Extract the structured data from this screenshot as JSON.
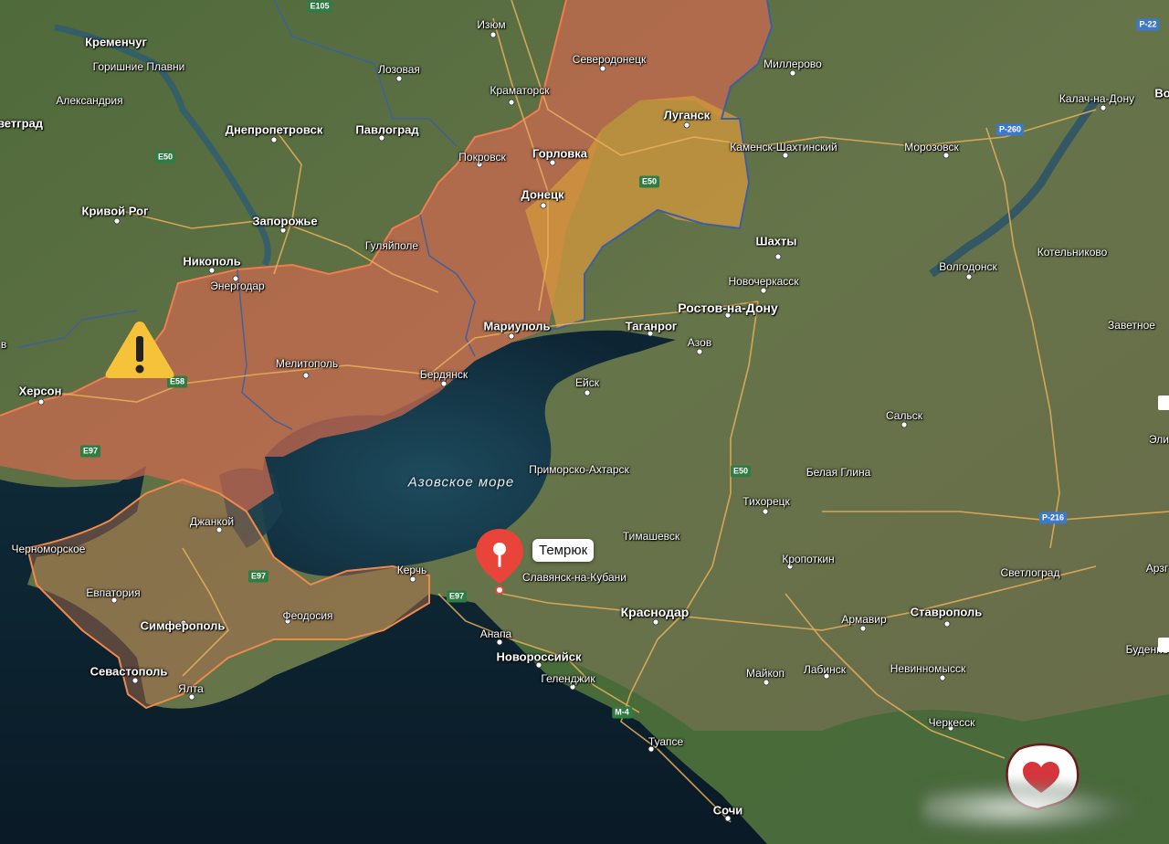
{
  "map": {
    "colors": {
      "land": "#5b6f3c",
      "water": "#0f2a3a",
      "occupied": "#d0684d",
      "occupied_pre2022": "#cf9b3c",
      "border": "#ef7a4a",
      "admin": "#3c5fa0",
      "road": "#e8b05a",
      "pin": "#e8443a"
    },
    "sea_label": "Азовское море",
    "cities": [
      {
        "name": "Кременчуг",
        "style": "big"
      },
      {
        "name": "Горишние Плавни",
        "style": ""
      },
      {
        "name": "Александрия",
        "style": ""
      },
      {
        "name": "ветград",
        "style": "big"
      },
      {
        "name": "Днепропетровск",
        "style": "big"
      },
      {
        "name": "Павлоград",
        "style": "big"
      },
      {
        "name": "Кривой Рог",
        "style": "big"
      },
      {
        "name": "Запорожье",
        "style": "big"
      },
      {
        "name": "Никополь",
        "style": "big"
      },
      {
        "name": "Энергодар",
        "style": ""
      },
      {
        "name": "Херсон",
        "style": "big"
      },
      {
        "name": "Мелитополь",
        "style": ""
      },
      {
        "name": "Бердянск",
        "style": ""
      },
      {
        "name": "Гуляйполе",
        "style": ""
      },
      {
        "name": "Мариуполь",
        "style": "big"
      },
      {
        "name": "Изюм",
        "style": ""
      },
      {
        "name": "Лозовая",
        "style": ""
      },
      {
        "name": "Краматорск",
        "style": ""
      },
      {
        "name": "Северодонецк",
        "style": ""
      },
      {
        "name": "Луганск",
        "style": "big"
      },
      {
        "name": "Покровск",
        "style": ""
      },
      {
        "name": "Горловка",
        "style": "big"
      },
      {
        "name": "Донецк",
        "style": "big"
      },
      {
        "name": "Миллерово",
        "style": ""
      },
      {
        "name": "Каменск-Шахтинский",
        "style": ""
      },
      {
        "name": "Морозовск",
        "style": ""
      },
      {
        "name": "Калач-на-Дону",
        "style": ""
      },
      {
        "name": "Шахты",
        "style": "big"
      },
      {
        "name": "Новочеркасск",
        "style": ""
      },
      {
        "name": "Ростов-на-Дону",
        "style": "major"
      },
      {
        "name": "Таганрог",
        "style": "big"
      },
      {
        "name": "Азов",
        "style": ""
      },
      {
        "name": "Волгодонск",
        "style": ""
      },
      {
        "name": "Котельниково",
        "style": ""
      },
      {
        "name": "Заветное",
        "style": ""
      },
      {
        "name": "Ейск",
        "style": ""
      },
      {
        "name": "Сальск",
        "style": ""
      },
      {
        "name": "Приморско-Ахтарск",
        "style": ""
      },
      {
        "name": "Белая Глина",
        "style": ""
      },
      {
        "name": "Тихорецк",
        "style": ""
      },
      {
        "name": "Тимашевск",
        "style": ""
      },
      {
        "name": "Кропоткин",
        "style": ""
      },
      {
        "name": "Светлоград",
        "style": ""
      },
      {
        "name": "Славянск-на-Кубани",
        "style": ""
      },
      {
        "name": "Краснодар",
        "style": "major"
      },
      {
        "name": "Армавир",
        "style": ""
      },
      {
        "name": "Ставрополь",
        "style": "big"
      },
      {
        "name": "Анапа",
        "style": ""
      },
      {
        "name": "Новороссийск",
        "style": "big"
      },
      {
        "name": "Геленджик",
        "style": ""
      },
      {
        "name": "Майкоп",
        "style": ""
      },
      {
        "name": "Лабинск",
        "style": ""
      },
      {
        "name": "Невинномысск",
        "style": ""
      },
      {
        "name": "Черкесск",
        "style": ""
      },
      {
        "name": "Туапсе",
        "style": ""
      },
      {
        "name": "Сочи",
        "style": "big"
      },
      {
        "name": "Джанкой",
        "style": ""
      },
      {
        "name": "Черноморское",
        "style": ""
      },
      {
        "name": "Керчь",
        "style": ""
      },
      {
        "name": "Евпатория",
        "style": ""
      },
      {
        "name": "Симферополь",
        "style": "big"
      },
      {
        "name": "Феодосия",
        "style": ""
      },
      {
        "name": "Севастополь",
        "style": "big"
      },
      {
        "name": "Ялта",
        "style": ""
      },
      {
        "name": "Буденно",
        "style": ""
      },
      {
        "name": "Арзг",
        "style": ""
      },
      {
        "name": "Эли",
        "style": ""
      },
      {
        "name": "Во",
        "style": "big"
      },
      {
        "name": "в",
        "style": ""
      }
    ],
    "roads": [
      "E105",
      "E50",
      "E50",
      "E58",
      "E97",
      "E97",
      "E97",
      "E50",
      "M-4",
      "P-22",
      "P-260",
      "P-216"
    ],
    "selected_place": "Темрюк"
  }
}
